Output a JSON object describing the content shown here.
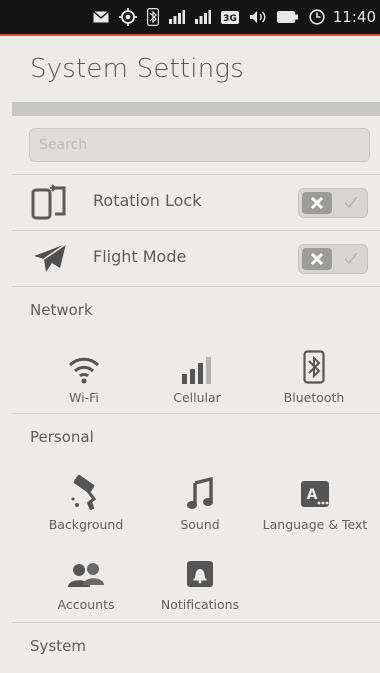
{
  "status_bar": {
    "time": "11:40",
    "icons": [
      "mail-icon",
      "location-icon",
      "bluetooth-icon",
      "signal-icon",
      "signal-icon",
      "3g-icon",
      "volume-icon",
      "battery-icon",
      "clock-icon"
    ]
  },
  "header": {
    "title": "System Settings"
  },
  "search": {
    "placeholder": "Search"
  },
  "toggles": [
    {
      "label": "Rotation Lock",
      "icon": "rotation-lock-icon",
      "state": "off"
    },
    {
      "label": "Flight Mode",
      "icon": "airplane-icon",
      "state": "off"
    }
  ],
  "sections": {
    "network": {
      "title": "Network",
      "items": [
        {
          "label": "Wi-Fi",
          "icon": "wifi-icon"
        },
        {
          "label": "Cellular",
          "icon": "cellular-icon"
        },
        {
          "label": "Bluetooth",
          "icon": "bluetooth-icon"
        }
      ]
    },
    "personal": {
      "title": "Personal",
      "items": [
        {
          "label": "Background",
          "icon": "paint-roller-icon"
        },
        {
          "label": "Sound",
          "icon": "music-note-icon"
        },
        {
          "label": "Language & Text",
          "icon": "keyboard-icon"
        },
        {
          "label": "Accounts",
          "icon": "accounts-icon"
        },
        {
          "label": "Notifications",
          "icon": "notification-bell-icon"
        }
      ]
    },
    "system": {
      "title": "System"
    }
  },
  "colors": {
    "status_accent": "#d9533a",
    "background": "#ecebe9",
    "toggle_knob": "#9b9b99"
  }
}
